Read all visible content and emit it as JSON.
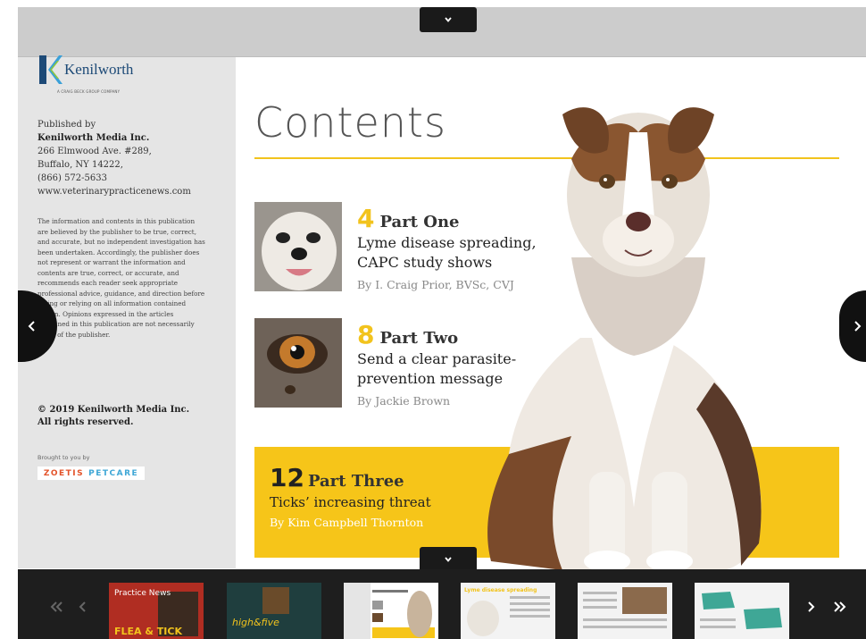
{
  "top_bar": {
    "collapse_icon": "chevron-down-icon"
  },
  "left_panel": {
    "logo": {
      "name": "Kenilworth",
      "tagline": "A CRAIG BECK GROUP COMPANY"
    },
    "published_by_label": "Published by",
    "publisher": "Kenilworth Media Inc.",
    "address_line1": "266 Elmwood Ave. #289,",
    "address_line2": "Buffalo, NY 14222,",
    "phone": "(866) 572-5633",
    "website": "www.veterinarypracticenews.com",
    "disclaimer": "The information and contents in this publication are believed by the publisher to be true, correct, and accurate, but no independent investigation has been undertaken. Accordingly, the publisher does not represent or warrant the information and contents are true, correct, or accurate, and recommends each reader seek appropriate professional advice, guidance, and direction before acting or relying on all information contained herein. Opinions expressed in the articles contained in this publication are not necessarily those of the publisher.",
    "copyright_line1": "© 2019 Kenilworth Media Inc.",
    "copyright_line2": "All rights reserved.",
    "brought_by": "Brought to you by",
    "sponsor_part1": "ZOETIS",
    "sponsor_part2": "PETCARE"
  },
  "contents": {
    "title": "Contents",
    "accent_color": "#f2c31d",
    "articles": [
      {
        "page": "4",
        "part": "Part One",
        "headline_line1": "Lyme disease spreading,",
        "headline_line2": "CAPC study shows",
        "byline": "By I. Craig Prior, BVSc, CVJ"
      },
      {
        "page": "8",
        "part": "Part Two",
        "headline_line1": "Send a clear parasite-",
        "headline_line2": "prevention message",
        "byline": "By Jackie Brown"
      },
      {
        "page": "12",
        "part": "Part Three",
        "headline_line1": "Ticks’ increasing threat",
        "headline_line2": "",
        "byline": "By Kim Campbell Thornton"
      }
    ]
  },
  "navigation": {
    "prev_icon": "chevron-left-icon",
    "next_icon": "chevron-right-icon",
    "first_icon": "double-chevron-left-icon",
    "last_icon": "double-chevron-right-icon"
  },
  "thumbnail_strip": {
    "items": [
      {
        "text_top": "Practice News",
        "text_bottom": "FLEA & TICK"
      },
      {
        "text_top": "",
        "text_bottom": "high&five"
      },
      {
        "text_top": "",
        "text_bottom": ""
      },
      {
        "text_top": "Lyme disease spreading",
        "text_bottom": ""
      },
      {
        "text_top": "",
        "text_bottom": ""
      },
      {
        "text_top": "",
        "text_bottom": ""
      }
    ]
  }
}
